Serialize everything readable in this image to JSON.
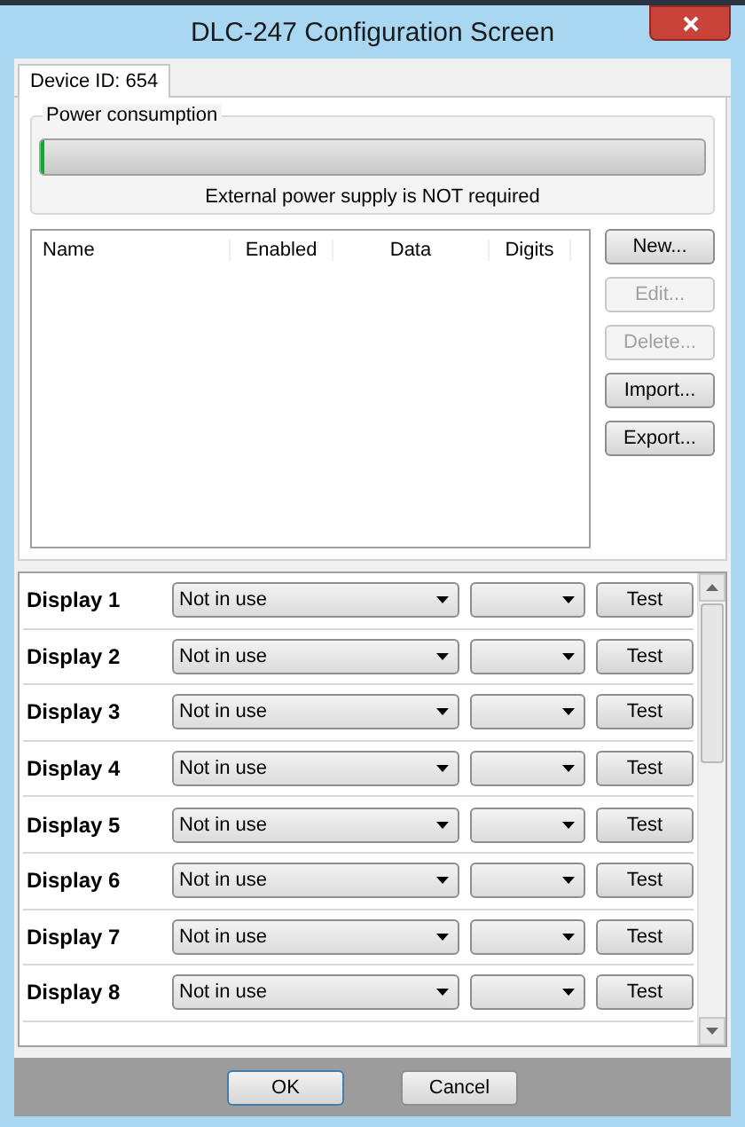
{
  "window": {
    "title": "DLC-247 Configuration Screen"
  },
  "tabs": [
    {
      "label": "Device ID: 654",
      "selected": true
    }
  ],
  "power": {
    "title": "Power consumption",
    "level": 0,
    "message": "External power supply is NOT required"
  },
  "list": {
    "columns": [
      "Name",
      "Enabled",
      "Data",
      "Digits"
    ]
  },
  "list_buttons": [
    {
      "label": "New...",
      "disabled": false
    },
    {
      "label": "Edit...",
      "disabled": true
    },
    {
      "label": "Delete...",
      "disabled": true
    },
    {
      "label": "Import...",
      "disabled": false
    },
    {
      "label": "Export...",
      "disabled": false
    }
  ],
  "displays": [
    {
      "name": "Display 1",
      "mode": "Not in use",
      "test": "Test"
    },
    {
      "name": "Display 2",
      "mode": "Not in use",
      "test": "Test"
    },
    {
      "name": "Display 3",
      "mode": "Not in use",
      "test": "Test"
    },
    {
      "name": "Display 4",
      "mode": "Not in use",
      "test": "Test"
    },
    {
      "name": "Display 5",
      "mode": "Not in use",
      "test": "Test"
    },
    {
      "name": "Display 6",
      "mode": "Not in use",
      "test": "Test"
    },
    {
      "name": "Display 7",
      "mode": "Not in use",
      "test": "Test"
    },
    {
      "name": "Display 8",
      "mode": "Not in use",
      "test": "Test"
    }
  ],
  "footer_buttons": [
    "OK",
    "Cancel"
  ]
}
